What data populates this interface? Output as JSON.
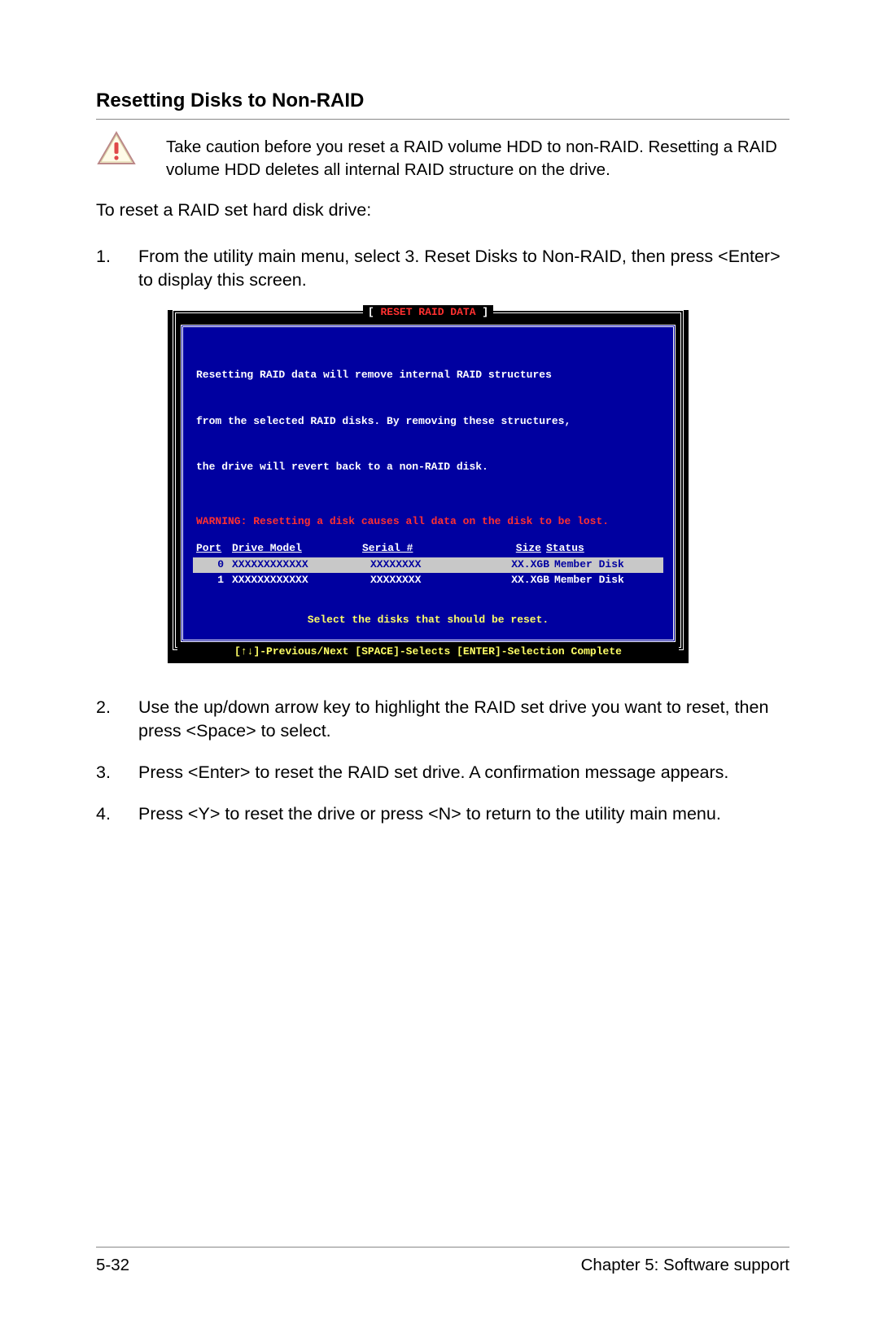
{
  "heading": "Resetting Disks to Non-RAID",
  "caution": "Take caution before you reset a RAID volume HDD to non-RAID. Resetting a RAID volume HDD deletes all internal RAID structure on the drive.",
  "intro": "To reset a RAID set hard disk drive:",
  "steps": {
    "s1": {
      "num": "1.",
      "text": "From the utility main menu, select 3. Reset Disks to Non-RAID, then press <Enter> to display this screen."
    },
    "s2": {
      "num": "2.",
      "text": "Use the up/down arrow key to highlight the RAID set drive you want to reset, then press <Space> to select."
    },
    "s3": {
      "num": "3.",
      "text": "Press <Enter> to reset the RAID set drive. A confirmation message appears."
    },
    "s4": {
      "num": "4.",
      "text": "Press <Y> to reset the drive or press <N> to return to the utility main menu."
    }
  },
  "bios": {
    "title_brackets_open": "[ ",
    "title_label": "RESET RAID DATA",
    "title_brackets_close": " ]",
    "desc1": "Resetting RAID data will remove internal RAID structures",
    "desc2": "from the selected RAID disks. By removing these structures,",
    "desc3": "the drive will revert back to a non-RAID disk.",
    "warning": "WARNING: Resetting a disk causes all data on the disk to be lost.",
    "cols": {
      "port": "Port",
      "model": "Drive Model",
      "serial": "Serial #",
      "size": "Size",
      "status": "Status"
    },
    "rows": {
      "r0": {
        "port": "0",
        "model": "XXXXXXXXXXXX",
        "serial": "XXXXXXXX",
        "size": "XX.XGB",
        "status": "Member Disk"
      },
      "r1": {
        "port": "1",
        "model": "XXXXXXXXXXXX",
        "serial": "XXXXXXXX",
        "size": "XX.XGB",
        "status": "Member Disk"
      }
    },
    "select_hint": "Select the disks that should be reset.",
    "footer": "[↑↓]-Previous/Next  [SPACE]-Selects  [ENTER]-Selection Complete"
  },
  "footer": {
    "page": "5-32",
    "chapter": "Chapter 5: Software support"
  }
}
